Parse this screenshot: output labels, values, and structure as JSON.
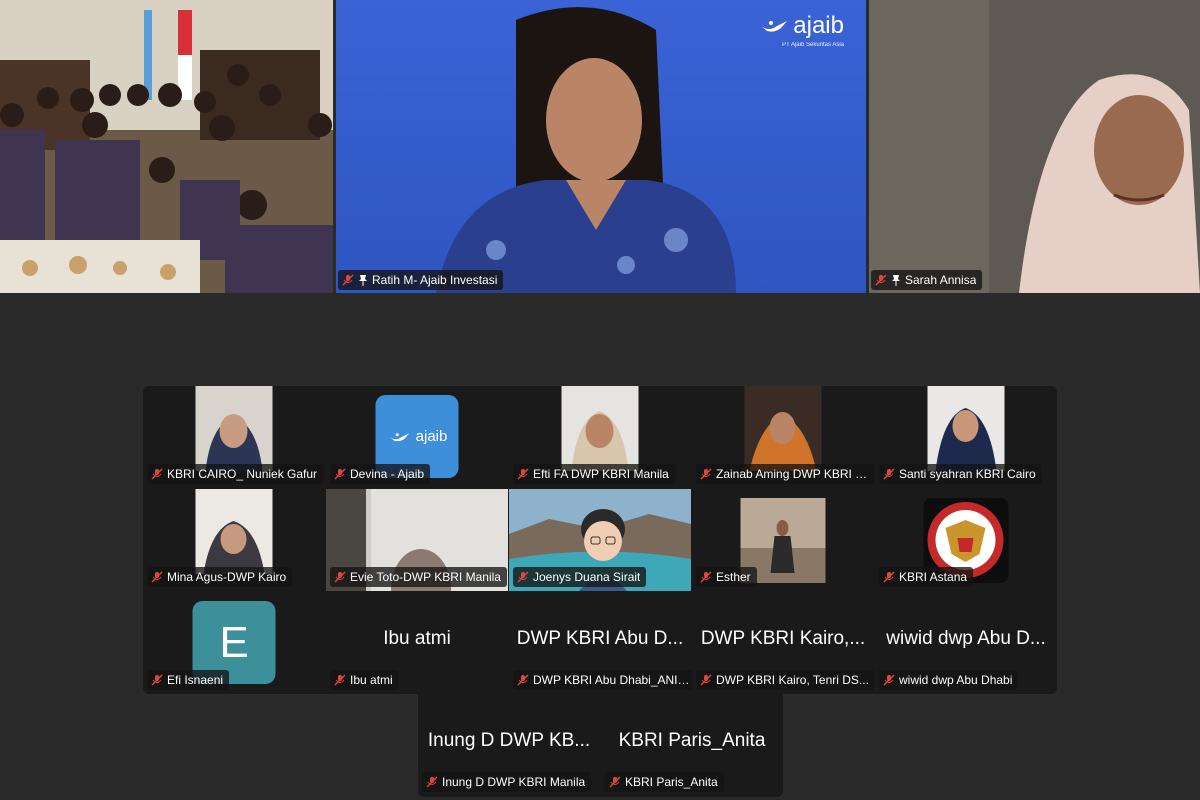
{
  "top_tiles": [
    {
      "name": "",
      "muted": false,
      "pinned": false,
      "speaking": true
    },
    {
      "name": "Ratih M- Ajaib Investasi",
      "muted": true,
      "pinned": true,
      "speaking": false,
      "brand": {
        "name": "ajaib",
        "subtitle": "PT Ajaib Sekuritas Asia"
      }
    },
    {
      "name": "Sarah Annisa",
      "muted": true,
      "pinned": true,
      "speaking": false
    }
  ],
  "gallery": [
    {
      "name": "KBRI CAIRO_ Nuniek Gafur",
      "muted": true,
      "kind": "video"
    },
    {
      "name": "Devina - Ajaib",
      "muted": true,
      "kind": "logo",
      "logo_text": "ajaib"
    },
    {
      "name": "Efti FA DWP KBRI Manila",
      "muted": true,
      "kind": "video"
    },
    {
      "name": "Zainab Aming DWP KBRI K...",
      "muted": true,
      "kind": "video"
    },
    {
      "name": "Santi  syahran KBRI Cairo",
      "muted": true,
      "kind": "video"
    },
    {
      "name": "Mina Agus-DWP Kairo",
      "muted": true,
      "kind": "video"
    },
    {
      "name": "Evie Toto-DWP KBRI Manila",
      "muted": true,
      "kind": "video"
    },
    {
      "name": "Joenys Duana Sirait",
      "muted": true,
      "kind": "video"
    },
    {
      "name": "Esther",
      "muted": true,
      "kind": "video"
    },
    {
      "name": "KBRI Astana",
      "muted": true,
      "kind": "seal",
      "seal_text": "EMBASSY OF THE REPUBLIC OF INDONESIA · ASTANA · KAZAKHSTAN"
    },
    {
      "name": "Efi Isnaeni",
      "muted": true,
      "kind": "letter",
      "letter": "E"
    },
    {
      "name": "Ibu atmi",
      "muted": true,
      "kind": "name",
      "display": "Ibu atmi"
    },
    {
      "name": "DWP KBRI Abu Dhabi_ANIT...",
      "muted": true,
      "kind": "name",
      "display": "DWP KBRI Abu D..."
    },
    {
      "name": "DWP KBRI Kairo, Tenri DS...",
      "muted": true,
      "kind": "name",
      "display": "DWP KBRI Kairo,..."
    },
    {
      "name": "wiwid dwp Abu Dhabi",
      "muted": true,
      "kind": "name",
      "display": "wiwid dwp Abu D..."
    }
  ],
  "gallery_bottom": [
    {
      "name": "Inung D DWP KBRI Manila",
      "muted": true,
      "kind": "name",
      "display": "Inung D DWP KB..."
    },
    {
      "name": "KBRI Paris_Anita",
      "muted": true,
      "kind": "name",
      "display": "KBRI Paris_Anita"
    }
  ],
  "colors": {
    "speaking_border": "#36c24a",
    "muted_mic": "#e0463a",
    "ajaib_blue": "#3c8fd8"
  }
}
